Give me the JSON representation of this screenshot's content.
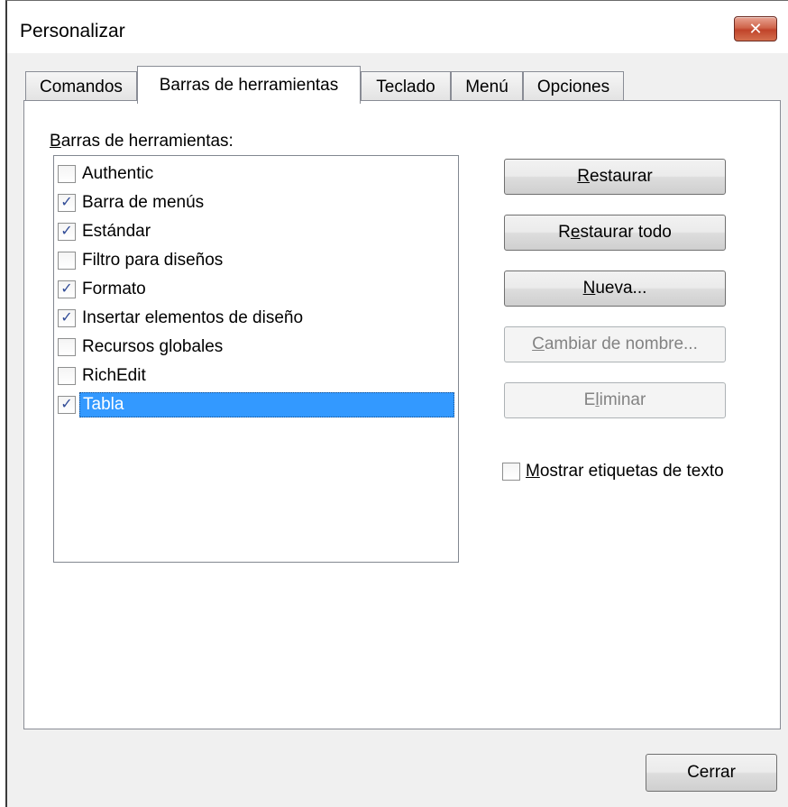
{
  "window": {
    "title": "Personalizar",
    "close_glyph": "✕"
  },
  "tabs": [
    {
      "label": "Comandos",
      "active": false
    },
    {
      "label": "Barras de herramientas",
      "active": true
    },
    {
      "label": "Teclado",
      "active": false
    },
    {
      "label": "Menú",
      "active": false
    },
    {
      "label": "Opciones",
      "active": false
    }
  ],
  "toolbars": {
    "label_mnemonic": "B",
    "label_rest": "arras de herramientas:",
    "items": [
      {
        "label": "Authentic",
        "checked": false,
        "selected": false
      },
      {
        "label": "Barra de menús",
        "checked": true,
        "selected": false
      },
      {
        "label": "Estándar",
        "checked": true,
        "selected": false
      },
      {
        "label": "Filtro para diseños",
        "checked": false,
        "selected": false
      },
      {
        "label": "Formato",
        "checked": true,
        "selected": false
      },
      {
        "label": "Insertar elementos de diseño",
        "checked": true,
        "selected": false
      },
      {
        "label": "Recursos globales",
        "checked": false,
        "selected": false
      },
      {
        "label": "RichEdit",
        "checked": false,
        "selected": false
      },
      {
        "label": "Tabla",
        "checked": true,
        "selected": true
      }
    ]
  },
  "buttons": {
    "reset_mn": "R",
    "reset_rest": "estaurar",
    "reset_all_pre": "R",
    "reset_all_mn": "e",
    "reset_all_rest": "staurar todo",
    "new_mn": "N",
    "new_rest": "ueva...",
    "rename_mn": "C",
    "rename_rest": "ambiar de nombre...",
    "delete_pre": "E",
    "delete_mn": "l",
    "delete_rest": "iminar",
    "close": "Cerrar"
  },
  "show_text_labels": {
    "mn": "M",
    "rest": "ostrar etiquetas de texto",
    "checked": false
  },
  "colors": {
    "selection": "#3399ff",
    "check": "#314c97",
    "close_button": "#c7432b"
  }
}
